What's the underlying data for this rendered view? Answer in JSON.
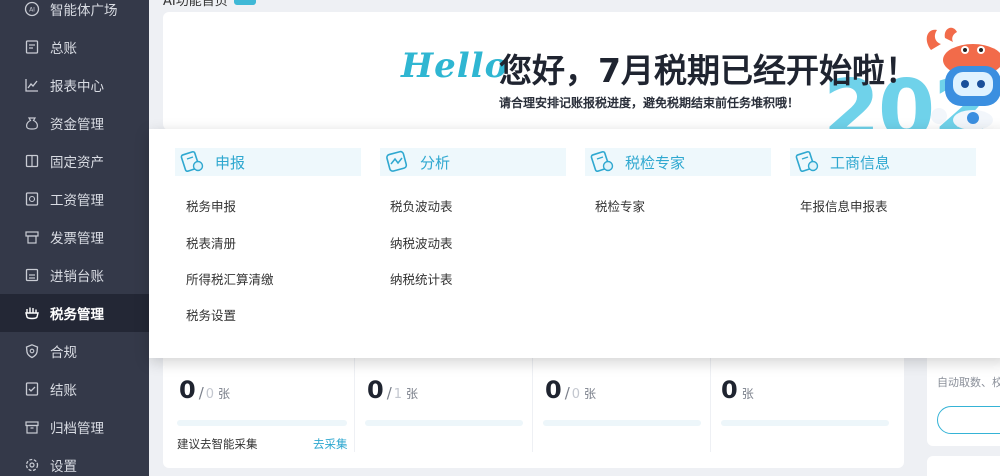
{
  "sidebar": {
    "items": [
      {
        "label": "智能体广场",
        "icon": "ai-icon",
        "active": false
      },
      {
        "label": "总账",
        "icon": "ledger-icon",
        "active": false
      },
      {
        "label": "报表中心",
        "icon": "chart-icon",
        "active": false
      },
      {
        "label": "资金管理",
        "icon": "money-bag-icon",
        "active": false
      },
      {
        "label": "固定资产",
        "icon": "asset-icon",
        "active": false
      },
      {
        "label": "工资管理",
        "icon": "salary-icon",
        "active": false
      },
      {
        "label": "发票管理",
        "icon": "invoice-icon",
        "active": false
      },
      {
        "label": "进销台账",
        "icon": "inventory-icon",
        "active": false
      },
      {
        "label": "税务管理",
        "icon": "tax-hand-icon",
        "active": true
      },
      {
        "label": "合规",
        "icon": "shield-icon",
        "active": false
      },
      {
        "label": "结账",
        "icon": "checkout-icon",
        "active": false
      },
      {
        "label": "归档管理",
        "icon": "archive-icon",
        "active": false
      },
      {
        "label": "设置",
        "icon": "gear-icon",
        "active": false
      }
    ]
  },
  "main": {
    "page_title": "AI功能首页",
    "banner": {
      "hello": "Hello",
      "headline": "您好，7月税期已经开始啦！",
      "subline": "请合理安排记账报税进度，避免税期结束前任务堆积哦！",
      "year_fragment": "202"
    },
    "stats": [
      {
        "value": "0",
        "total": "0",
        "unit": "张",
        "hint": "建议去智能采集",
        "link": "去采集"
      },
      {
        "value": "0",
        "total": "1",
        "unit": "张"
      },
      {
        "value": "0",
        "total": "0",
        "unit": "张"
      },
      {
        "value": "0",
        "unit": "张"
      }
    ],
    "right_card": {
      "text": "自动取数、校"
    }
  },
  "mega_menu": {
    "columns": [
      {
        "title": "申报",
        "icon": "declare-icon",
        "links": [
          "税务申报",
          "税表清册",
          "所得税汇算清缴",
          "税务设置"
        ]
      },
      {
        "title": "分析",
        "icon": "analysis-icon",
        "links": [
          "税负波动表",
          "纳税波动表",
          "纳税统计表"
        ]
      },
      {
        "title": "税检专家",
        "icon": "tax-check-icon",
        "links": [
          "税检专家"
        ]
      },
      {
        "title": "工商信息",
        "icon": "business-info-icon",
        "links": [
          "年报信息申报表"
        ]
      }
    ]
  },
  "colors": {
    "sidebar_bg": "#343949",
    "sidebar_active_bg": "#232735",
    "accent": "#2fa8d0",
    "brand_cyan": "#2fb6d2"
  }
}
